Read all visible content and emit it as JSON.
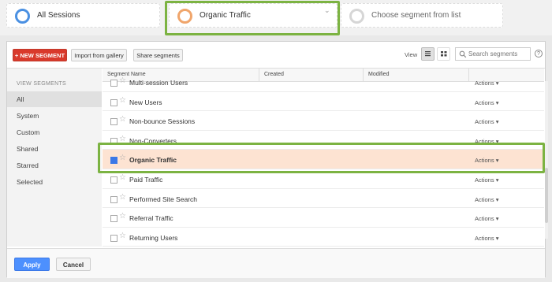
{
  "segments_bar": {
    "cards": [
      {
        "label": "All Sessions",
        "ring_color": "#4a90e2"
      },
      {
        "label": "Organic Traffic",
        "ring_color": "#f0a56b"
      },
      {
        "label": "Choose segment from list",
        "ring_color": "#d6d6d6"
      }
    ]
  },
  "toolbar": {
    "new_segment_label": "+ NEW SEGMENT",
    "import_label": "Import from gallery",
    "share_label": "Share segments",
    "view_label": "View",
    "search_placeholder": "Search segments",
    "help_label": "?"
  },
  "sidebar": {
    "heading": "VIEW SEGMENTS",
    "items": [
      {
        "label": "All",
        "active": true
      },
      {
        "label": "System"
      },
      {
        "label": "Custom"
      },
      {
        "label": "Shared"
      },
      {
        "label": "Starred"
      },
      {
        "label": "Selected"
      }
    ]
  },
  "table": {
    "columns": [
      "Segment Name",
      "Created",
      "Modified"
    ],
    "rows": [
      {
        "name": "Multi-session Users",
        "actions": "Actions",
        "checked": false
      },
      {
        "name": "New Users",
        "actions": "Actions",
        "checked": false
      },
      {
        "name": "Non-bounce Sessions",
        "actions": "Actions",
        "checked": false
      },
      {
        "name": "Non-Converters",
        "actions": "Actions",
        "checked": false
      },
      {
        "name": "Organic Traffic",
        "actions": "Actions",
        "checked": true
      },
      {
        "name": "Paid Traffic",
        "actions": "Actions",
        "checked": false
      },
      {
        "name": "Performed Site Search",
        "actions": "Actions",
        "checked": false
      },
      {
        "name": "Referral Traffic",
        "actions": "Actions",
        "checked": false
      },
      {
        "name": "Returning Users",
        "actions": "Actions",
        "checked": false
      }
    ]
  },
  "footer": {
    "apply_label": "Apply",
    "cancel_label": "Cancel"
  },
  "colors": {
    "accent_red": "#d9392b",
    "apply_blue": "#4d90fe",
    "highlight_green": "#7cb342",
    "selected_row": "#fde3d2"
  }
}
